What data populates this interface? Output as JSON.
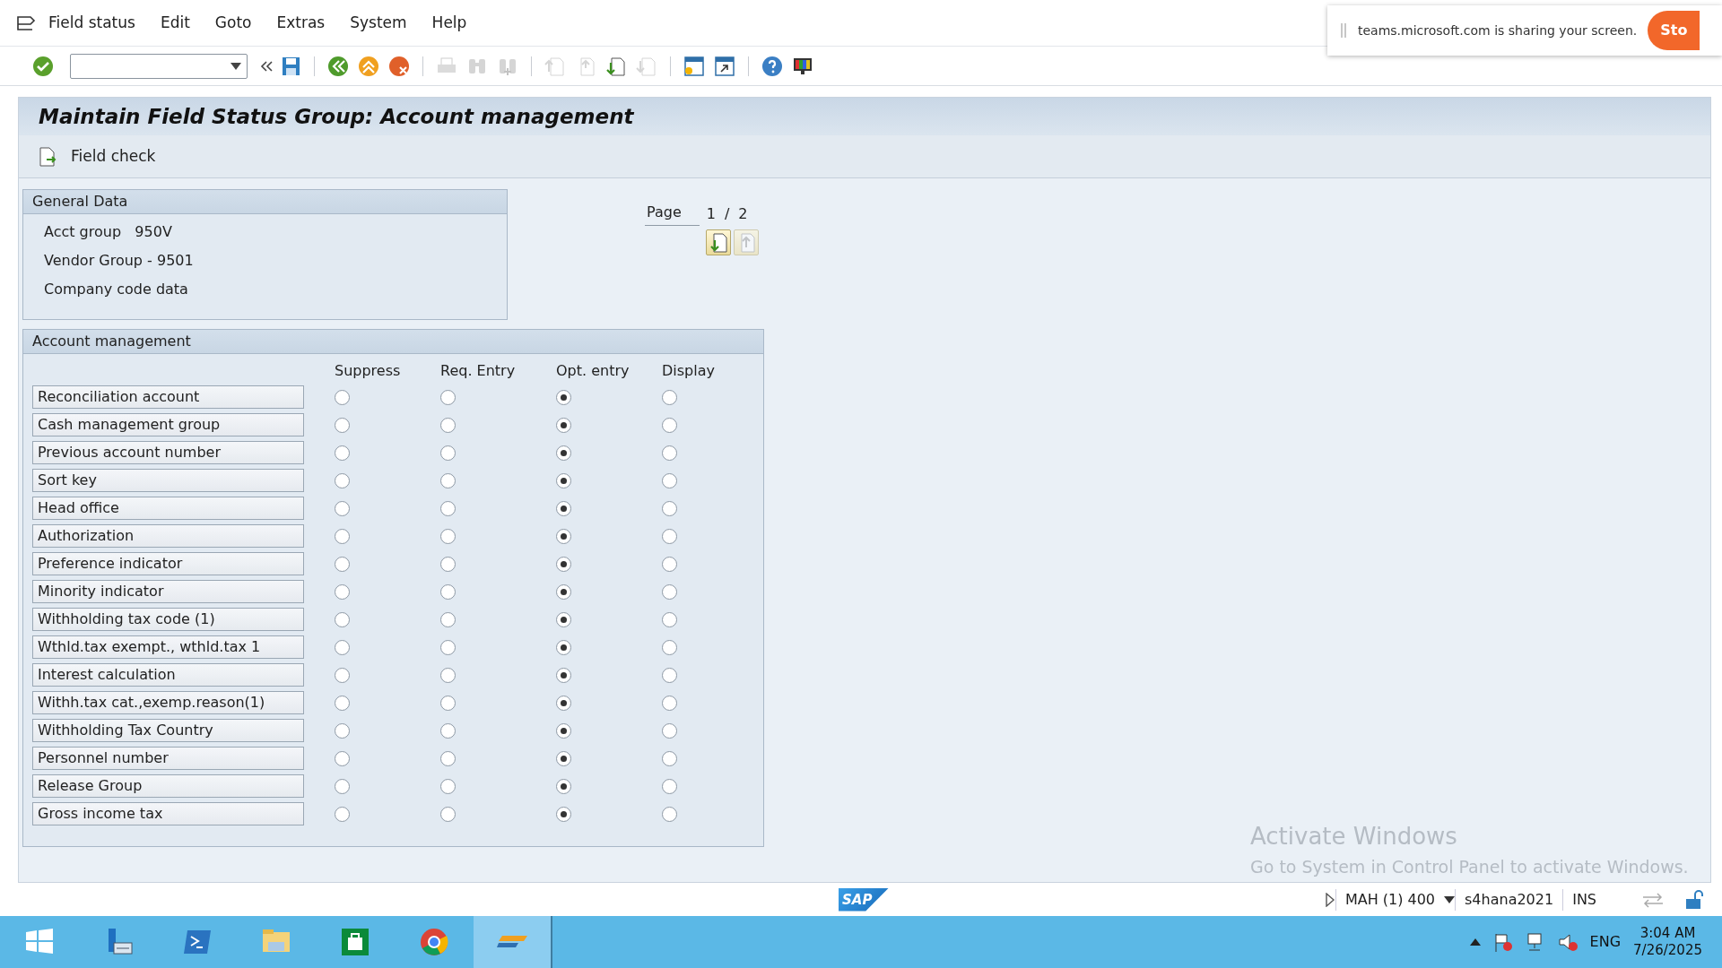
{
  "menu": [
    "Field status",
    "Edit",
    "Goto",
    "Extras",
    "System",
    "Help"
  ],
  "toolbar": [
    {
      "disabled": false
    },
    {
      "disabled": false
    },
    {
      "disabled": false
    },
    {
      "disabled": false
    },
    {
      "disabled": false
    },
    {
      "disabled": true
    },
    {
      "disabled": true
    },
    {
      "disabled": true
    },
    {
      "disabled": true
    },
    {
      "disabled": true
    },
    {
      "disabled": false
    },
    {
      "disabled": true
    },
    {
      "disabled": false
    },
    {
      "disabled": false
    },
    {
      "disabled": false
    },
    {
      "disabled": false
    }
  ],
  "screen_title": "Maintain Field Status Group: Account management",
  "app_toolbar": {
    "label": "Field check"
  },
  "general_data": {
    "title": "General Data",
    "lines": [
      "Acct group   950V",
      "Vendor Group - 9501",
      "Company code data"
    ]
  },
  "pager": {
    "label": "Page",
    "current": "1",
    "separator": "/",
    "total": "2",
    "buttons": [
      {
        "disabled": false
      },
      {
        "disabled": true
      }
    ]
  },
  "account_management": {
    "title": "Account management",
    "columns": [
      "Suppress",
      "Req. Entry",
      "Opt. entry",
      "Display"
    ],
    "rows": [
      {
        "label": "Reconciliation account",
        "options": [
          {
            "selected": false
          },
          {
            "selected": false
          },
          {
            "selected": true
          },
          {
            "selected": false
          }
        ]
      },
      {
        "label": "Cash management group",
        "options": [
          {
            "selected": false
          },
          {
            "selected": false
          },
          {
            "selected": true
          },
          {
            "selected": false
          }
        ]
      },
      {
        "label": "Previous account number",
        "options": [
          {
            "selected": false
          },
          {
            "selected": false
          },
          {
            "selected": true
          },
          {
            "selected": false
          }
        ]
      },
      {
        "label": "Sort key",
        "options": [
          {
            "selected": false
          },
          {
            "selected": false
          },
          {
            "selected": true
          },
          {
            "selected": false
          }
        ]
      },
      {
        "label": "Head office",
        "options": [
          {
            "selected": false
          },
          {
            "selected": false
          },
          {
            "selected": true
          },
          {
            "selected": false
          }
        ]
      },
      {
        "label": "Authorization",
        "options": [
          {
            "selected": false
          },
          {
            "selected": false
          },
          {
            "selected": true
          },
          {
            "selected": false
          }
        ]
      },
      {
        "label": "Preference indicator",
        "options": [
          {
            "selected": false
          },
          {
            "selected": false
          },
          {
            "selected": true
          },
          {
            "selected": false
          }
        ]
      },
      {
        "label": "Minority indicator",
        "options": [
          {
            "selected": false
          },
          {
            "selected": false
          },
          {
            "selected": true
          },
          {
            "selected": false
          }
        ]
      },
      {
        "label": "Withholding tax code (1)",
        "options": [
          {
            "selected": false
          },
          {
            "selected": false
          },
          {
            "selected": true
          },
          {
            "selected": false
          }
        ]
      },
      {
        "label": "Wthld.tax exempt., wthld.tax 1",
        "options": [
          {
            "selected": false
          },
          {
            "selected": false
          },
          {
            "selected": true
          },
          {
            "selected": false
          }
        ]
      },
      {
        "label": "Interest calculation",
        "options": [
          {
            "selected": false
          },
          {
            "selected": false
          },
          {
            "selected": true
          },
          {
            "selected": false
          }
        ]
      },
      {
        "label": "Withh.tax cat.,exemp.reason(1)",
        "options": [
          {
            "selected": false
          },
          {
            "selected": false
          },
          {
            "selected": true
          },
          {
            "selected": false
          }
        ]
      },
      {
        "label": "Withholding Tax Country",
        "options": [
          {
            "selected": false
          },
          {
            "selected": false
          },
          {
            "selected": true
          },
          {
            "selected": false
          }
        ]
      },
      {
        "label": "Personnel number",
        "options": [
          {
            "selected": false
          },
          {
            "selected": false
          },
          {
            "selected": true
          },
          {
            "selected": false
          }
        ]
      },
      {
        "label": "Release Group",
        "options": [
          {
            "selected": false
          },
          {
            "selected": false
          },
          {
            "selected": true
          },
          {
            "selected": false
          }
        ]
      },
      {
        "label": "Gross income tax",
        "options": [
          {
            "selected": false
          },
          {
            "selected": false
          },
          {
            "selected": true
          },
          {
            "selected": false
          }
        ]
      }
    ]
  },
  "activation_notice": {
    "title": "Activate Windows",
    "text": "Go to System in Control Panel to activate Windows."
  },
  "status_bar": {
    "logo": "SAP",
    "system": "MAH (1) 400",
    "server": "s4hana2021",
    "mode": "INS"
  },
  "share_banner": {
    "text": "teams.microsoft.com is sharing your screen.",
    "button": "Sto"
  },
  "taskbar": {
    "language": "ENG",
    "time": "3:04 AM",
    "date": "7/26/2025"
  }
}
